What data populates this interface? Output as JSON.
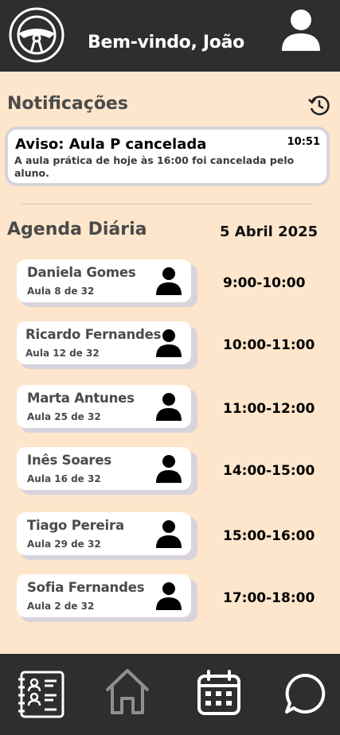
{
  "header": {
    "welcome": "Bem-vindo, João",
    "logo_icon": "steering-wheel-icon",
    "avatar_icon": "user-icon"
  },
  "notifications": {
    "title": "Notificações",
    "history_icon": "history-icon",
    "items": [
      {
        "title": "Aviso: Aula P cancelada",
        "time": "10:51",
        "body": "A aula prática de hoje às 16:00 foi cancelada pelo aluno."
      }
    ]
  },
  "agenda": {
    "title": "Agenda Diária",
    "date": "5 Abril 2025",
    "entries": [
      {
        "name": "Daniela Gomes",
        "lesson": "Aula 8 de 32",
        "time": "9:00-10:00"
      },
      {
        "name": "Ricardo Fernandes",
        "lesson": "Aula 12 de 32",
        "time": "10:00-11:00"
      },
      {
        "name": "Marta Antunes",
        "lesson": "Aula 25 de 32",
        "time": "11:00-12:00"
      },
      {
        "name": "Inês Soares",
        "lesson": "Aula 16 de 32",
        "time": "14:00-15:00"
      },
      {
        "name": "Tiago Pereira",
        "lesson": "Aula 29 de 32",
        "time": "15:00-16:00"
      },
      {
        "name": "Sofia Fernandes",
        "lesson": "Aula 2 de 32",
        "time": "17:00-18:00"
      }
    ]
  },
  "nav": {
    "items": [
      {
        "icon": "student-list-icon",
        "active": false
      },
      {
        "icon": "home-icon",
        "active": true
      },
      {
        "icon": "calendar-icon",
        "active": false
      },
      {
        "icon": "chat-icon",
        "active": false
      }
    ]
  },
  "colors": {
    "background": "#fde6cb",
    "header": "#2e2e2e",
    "card": "#ffffff",
    "card_shadow": "#d9d3dc"
  }
}
